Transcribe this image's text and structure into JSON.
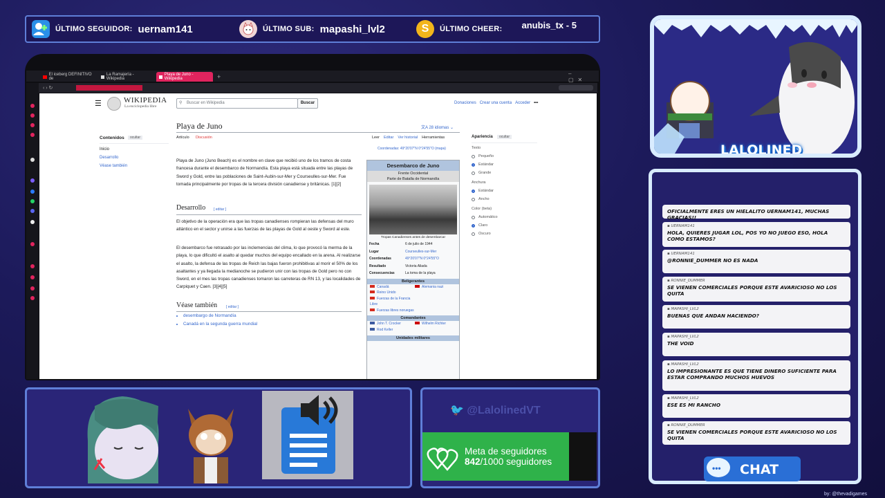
{
  "alerts": {
    "follower_label": "ÚLTIMO SEGUIDOR:",
    "follower_value": "uernam141",
    "sub_label": "ÚLTIMO SUB:",
    "sub_value": "mapashi_lvl2",
    "cheer_label": "ÚLTIMO CHEER:",
    "cheer_value": "anubis_tx - 5"
  },
  "browser": {
    "tabs": [
      "El iceberg DEFINITIVO de",
      "La Ramajería - Wikipedia",
      "Playa de Juno - Wikipedia"
    ]
  },
  "wiki": {
    "logo_title": "WIKIPEDIA",
    "logo_sub": "La enciclopedia libre",
    "search_placeholder": "Buscar en Wikipedia",
    "search_button": "Buscar",
    "top_links": [
      "Donaciones",
      "Crear una cuenta",
      "Acceder"
    ],
    "page_title": "Playa de Juno",
    "languages": "28 idiomas",
    "view_tabs": [
      "Artículo",
      "Discusión"
    ],
    "action_tabs": [
      "Leer",
      "Editar",
      "Ver historial",
      "Herramientas"
    ],
    "coords_label": "Coordenadas:",
    "coords_value": "49°20′07″N 0°24′55″O (mapa)",
    "toc_title": "Contenidos",
    "toc_hide": "ocultar",
    "toc_items": [
      "Inicio",
      "Desarrollo",
      "Véase también"
    ],
    "intro": "Playa de Juno (Juno Beach) es el nombre en clave que recibió uno de los tramos de costa francesa durante el desembarco de Normandía. Esta playa está situada entre las playas de Sword y Gold, entre las poblaciones de Saint-Aubin-sur-Mer y Courseulles-sur-Mer. Fue tomada principalmente por tropas de la tercera división canadiense y británicas. [1][2]",
    "section1": "Desarrollo",
    "edit": "editar",
    "p1": "El objetivo de la operación era que las tropas canadienses rompieran las defensas del muro atlántico en el sector y unirse a las fuerzas de las playas de Gold al oeste y Sword al este.",
    "p2": "El desembarco fue retrasado por las inclemencias del clima, lo que provocó la merma de la playa, lo que dificultó el asalto al quedar muchos del equipo encallado en la arena. Al realizarse el asalto, la defensa de las tropas de Reich las bajas fueron prohibitivas al morir el 50% de los asaltantes y ya llegada la medianoche se pudieron unir con las tropas de Gold pero no con Sword, en el mes las tropas canadienses tomaron las carreteras de RN 13, y las localidades de Carpiquet y Caen. [3][4][5]",
    "section2": "Véase también",
    "see_also": [
      "desembargo de Normandía",
      "Canadá en la segunda guerra mundial"
    ],
    "infobox_title": "Desembarco de Juno",
    "infobox_sub1": "Frente Occidental",
    "infobox_sub2": "Parte de Batalla de Normandía",
    "infobox_caption": "Tropas Canadienses antes de desembarcar",
    "infobox_rows": [
      {
        "k": "Fecha",
        "v": "6 de julio de 1944"
      },
      {
        "k": "Lugar",
        "v": "Courseulles-sur-Mer"
      },
      {
        "k": "Coordenadas",
        "v": "49°20′07″N 0°24′55″O"
      },
      {
        "k": "Resultado",
        "v": "Victoria Aliada"
      },
      {
        "k": "Consecuencias",
        "v": "La toma de la playa"
      }
    ],
    "belligerents_title": "Beligerantes",
    "belligerents_left": [
      "Canadá",
      "Reino Unido",
      "Fuerzas de la Francia Libre",
      "Fuerzas libres noruegas"
    ],
    "belligerents_right": [
      "Alemania nazi"
    ],
    "commanders_title": "Comandantes",
    "commanders_left": [
      "John T. Crocker",
      "Rod Keller"
    ],
    "commanders_right": [
      "Wilhelm Richter"
    ],
    "units_title": "Unidades militares",
    "appearance_title": "Apariencia",
    "appearance_hide": "ocultar",
    "text_label": "Texto",
    "text_options": [
      "Pequeño",
      "Estándar",
      "Grande"
    ],
    "width_label": "Anchura",
    "width_options": [
      "Estándar",
      "Ancho"
    ],
    "color_label": "Color (beta)",
    "color_options": [
      "Automático",
      "Claro",
      "Oscuro"
    ]
  },
  "streamer": {
    "name": "LALOLINED",
    "watermark": "@LalolinedVT",
    "goal_title": "Meta de seguidores",
    "goal_current": "842",
    "goal_total": "/1000 seguidores",
    "goal_progress": 0.842,
    "chat_button": "CHAT",
    "credit": "by: @thevadigames"
  },
  "chat": [
    {
      "user": "",
      "text": "OFICIALMENTE ERES UN HIELALITO UERNAM141, MUCHAS GRACIAS!!"
    },
    {
      "user": "UERNAM141",
      "text": "HOLA, QUIERES JUGAR LOL, POS YO NO JUEGO ESO, HOLA COMO ESTAMOS?"
    },
    {
      "user": "UERNAM141",
      "text": "@RONNIE_DUMMER NO ES NADA"
    },
    {
      "user": "RONNIE_DUMMER",
      "text": "SE VIENEN COMERCIALES PORQUE ESTE AVARICIOSO NO LOS QUITA"
    },
    {
      "user": "MAPASHI_LVL2",
      "text": "BUENAS QUE ANDAN HACIENDO?"
    },
    {
      "user": "MAPASHI_LVL2",
      "text": "THE VOID"
    },
    {
      "user": "MAPASHI_LVL2",
      "text": "LO IMPRESIONANTE ES QUE TIENE DINERO SUFICIENTE PARA ESTAR COMPRANDO MUCHOS HUEVOS"
    },
    {
      "user": "MAPASHI_LVL2",
      "text": "ESE ES MI RANCHO"
    },
    {
      "user": "RONNIE_DUMMER",
      "text": "SE VIENEN COMERCIALES PORQUE ESTE AVARICIOSO NO LOS QUITA"
    }
  ],
  "colors": {
    "accent": "#5f7fd8",
    "goal_green": "#2fb24a",
    "ice": "#d9ecff"
  }
}
